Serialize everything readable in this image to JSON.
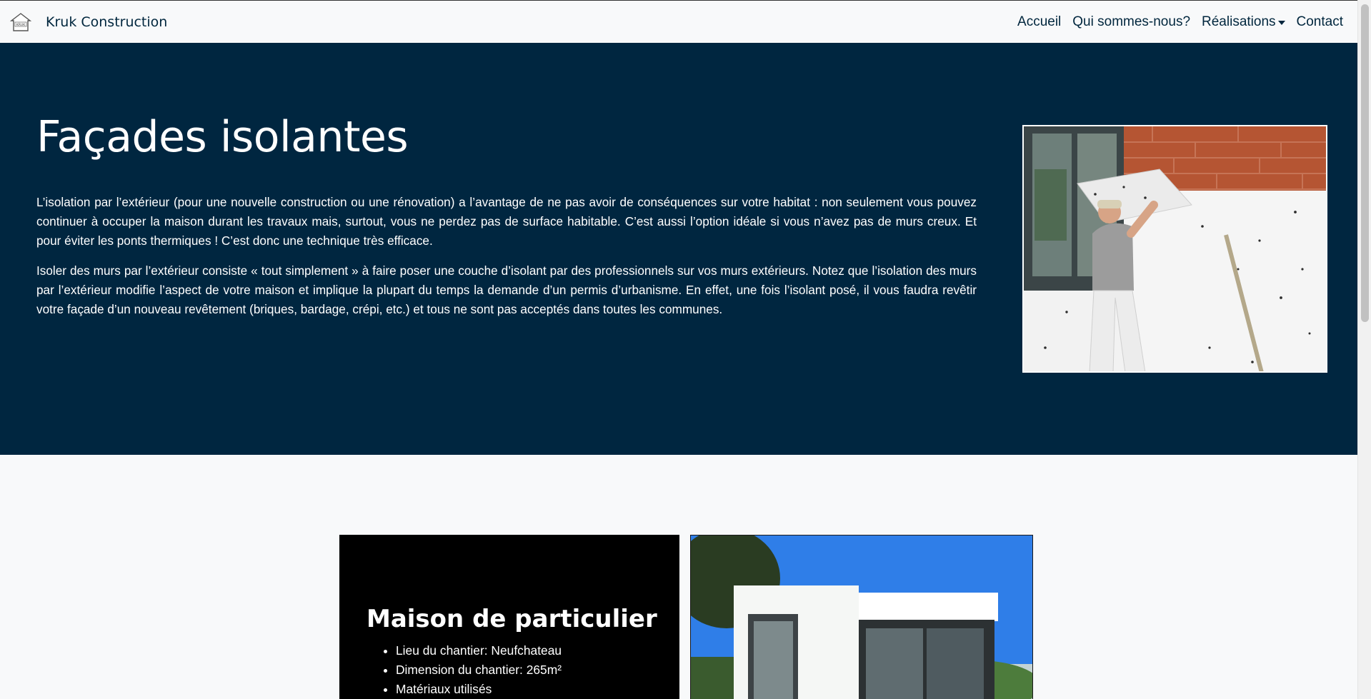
{
  "navbar": {
    "brand_name": "Kruk Construction",
    "logo_icon": "house-logo-icon",
    "links": [
      {
        "label": "Accueil"
      },
      {
        "label": "Qui sommes-nous?"
      },
      {
        "label": "Réalisations",
        "has_dropdown": true
      },
      {
        "label": "Contact"
      }
    ]
  },
  "hero": {
    "title": "Façades isolantes",
    "paragraphs": [
      "L’isolation par l’extérieur (pour une nouvelle construction ou une rénovation) a l’avantage de ne pas avoir de conséquences sur votre habitat : non seulement vous pouvez continuer à occuper la maison durant les travaux mais, surtout, vous ne perdez pas de surface habitable. C’est aussi l’option idéale si vous n’avez pas de murs creux. Et pour éviter les ponts thermiques ! C’est donc une technique très efficace.",
      "Isoler des murs par l’extérieur consiste « tout simplement » à faire poser une couche d’isolant par des professionnels sur vos murs extérieurs. Notez que l’isolation des murs par l’extérieur modifie l’aspect de votre maison et implique la plupart du temps la demande d’un permis d’urbanisme. En effet, une fois l’isolant posé, il vous faudra revêtir votre façade d’un nouveau revêtement (briques, bardage, crépi, etc.) et tous ne sont pas acceptés dans toutes les communes."
    ],
    "background_color": "#002640"
  },
  "project": {
    "title": "Maison de particulier",
    "details": [
      "Lieu du chantier: Neufchateau",
      "Dimension du chantier: 265m²",
      "Matériaux utilisés"
    ]
  },
  "colors": {
    "accent": "#00263d",
    "page_background": "#f8f9fa",
    "card_background": "#000000"
  }
}
